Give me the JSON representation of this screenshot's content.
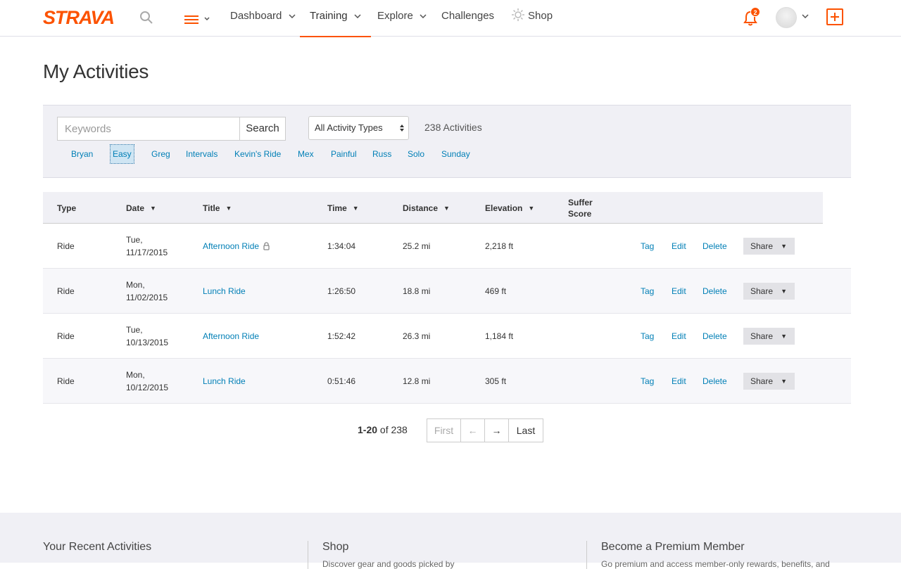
{
  "brand": {
    "name": "STRAVA",
    "accent": "#fc5200",
    "link": "#007fb6"
  },
  "nav": {
    "dashboard": "Dashboard",
    "training": "Training",
    "explore": "Explore",
    "challenges": "Challenges",
    "shop": "Shop"
  },
  "notifications": {
    "count": "2"
  },
  "page": {
    "title": "My Activities"
  },
  "filters": {
    "keywords_placeholder": "Keywords",
    "search_label": "Search",
    "activity_type": "All Activity Types",
    "count": "238 Activities",
    "tags": [
      "Bryan",
      "Easy",
      "Greg",
      "Intervals",
      "Kevin's Ride",
      "Mex",
      "Painful",
      "Russ",
      "Solo",
      "Sunday"
    ]
  },
  "table": {
    "headers": {
      "type": "Type",
      "date": "Date",
      "title": "Title",
      "time": "Time",
      "distance": "Distance",
      "elevation": "Elevation",
      "suffer": "Suffer Score"
    },
    "actions": {
      "tag": "Tag",
      "edit": "Edit",
      "delete": "Delete",
      "share": "Share"
    },
    "rows": [
      {
        "type": "Ride",
        "date_day": "Tue,",
        "date": "11/17/2015",
        "title": "Afternoon Ride",
        "private": true,
        "time": "1:34:04",
        "distance": "25.2 mi",
        "elevation": "2,218 ft"
      },
      {
        "type": "Ride",
        "date_day": "Mon,",
        "date": "11/02/2015",
        "title": "Lunch Ride",
        "private": false,
        "time": "1:26:50",
        "distance": "18.8 mi",
        "elevation": "469 ft"
      },
      {
        "type": "Ride",
        "date_day": "Tue,",
        "date": "10/13/2015",
        "title": "Afternoon Ride",
        "private": false,
        "time": "1:52:42",
        "distance": "26.3 mi",
        "elevation": "1,184 ft"
      },
      {
        "type": "Ride",
        "date_day": "Mon,",
        "date": "10/12/2015",
        "title": "Lunch Ride",
        "private": false,
        "time": "0:51:46",
        "distance": "12.8 mi",
        "elevation": "305 ft"
      }
    ]
  },
  "pagination": {
    "range": "1-20",
    "of": "of 238",
    "first": "First",
    "prev": "←",
    "next": "→",
    "last": "Last"
  },
  "footer": {
    "recent": "Your Recent Activities",
    "shop": "Shop",
    "shop_sub": "Discover gear and goods picked by",
    "premium": "Become a Premium Member",
    "premium_sub": "Go premium and access member-only rewards, benefits, and"
  }
}
